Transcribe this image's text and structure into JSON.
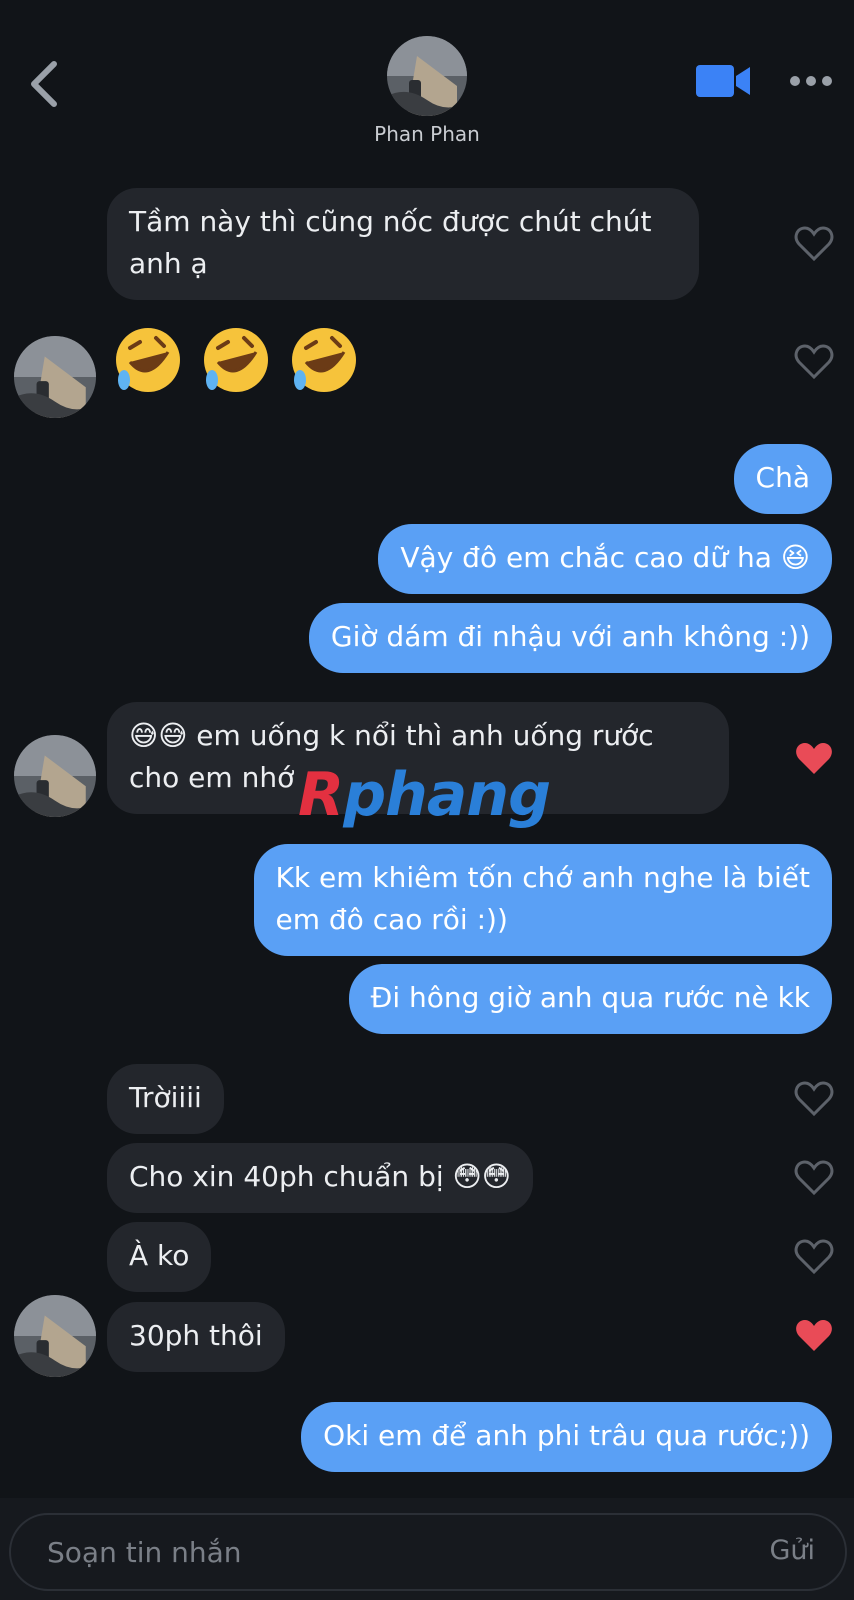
{
  "header": {
    "contact_name": "Phan Phan",
    "back_icon": "chevron-left-icon",
    "video_icon": "video-camera-icon",
    "more_icon": "more-horizontal-icon",
    "accent_color": "#3b82f6"
  },
  "messages": [
    {
      "side": "in",
      "text": "Tầm này thì cũng nốc được chút chút",
      "text2": "anh ạ",
      "reaction": "heart-outline"
    },
    {
      "side": "in",
      "emoji": "🤣🤣🤣",
      "reaction": "heart-outline"
    },
    {
      "side": "out",
      "text": "Chà"
    },
    {
      "side": "out",
      "text": "Vậy đô em chắc cao dữ ha",
      "emoji": "😆"
    },
    {
      "side": "out",
      "text": "Giờ dám đi nhậu với anh không :))"
    },
    {
      "side": "in",
      "emoji": "😅😅",
      "text": "em uống k nổi thì anh uống rước",
      "text2": "cho em nhớ",
      "reaction": "heart-filled"
    },
    {
      "side": "out",
      "text": "Kk em khiêm tốn chớ anh nghe là biết",
      "text2": "em đô cao rồi :))"
    },
    {
      "side": "out",
      "text": "Đi hông giờ anh qua rước nè kk"
    },
    {
      "side": "in",
      "text": "Trờiiii",
      "reaction": "heart-outline"
    },
    {
      "side": "in",
      "text": "Cho xin 40ph chuẩn bị",
      "emoji": "😳😳",
      "reaction": "heart-outline"
    },
    {
      "side": "in",
      "text": "À ko",
      "reaction": "heart-outline"
    },
    {
      "side": "in",
      "text": "30ph thôi",
      "reaction": "heart-filled"
    },
    {
      "side": "out",
      "text": "Oki em để anh phi trâu qua rước;))"
    }
  ],
  "watermark": {
    "first": "R",
    "rest": "phang"
  },
  "composer": {
    "placeholder": "Soạn tin nhắn",
    "send_label": "Gửi"
  },
  "colors": {
    "background": "#111418",
    "incoming_bubble": "#23262c",
    "outgoing_bubble": "#5aa0f5",
    "heart_filled": "#e94b57",
    "heart_outline": "#5d626a"
  }
}
